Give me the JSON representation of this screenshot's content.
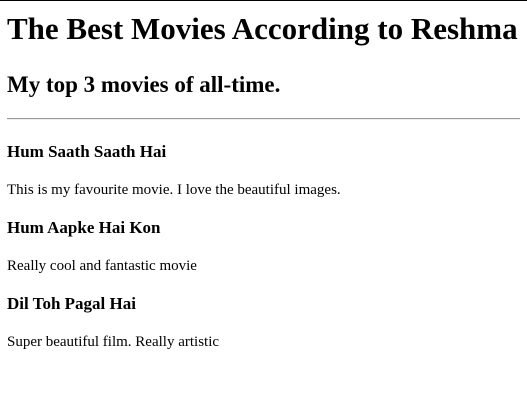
{
  "page": {
    "title": "The Best Movies According to Reshma",
    "subtitle": "My top 3 movies of all-time."
  },
  "movies": [
    {
      "title": "Hum Saath Saath Hai",
      "description": "This is my favourite movie. I love the beautiful images."
    },
    {
      "title": "Hum Aapke Hai Kon",
      "description": "Really cool and fantastic movie"
    },
    {
      "title": "Dil Toh Pagal Hai",
      "description": "Super beautiful film. Really artistic"
    }
  ]
}
